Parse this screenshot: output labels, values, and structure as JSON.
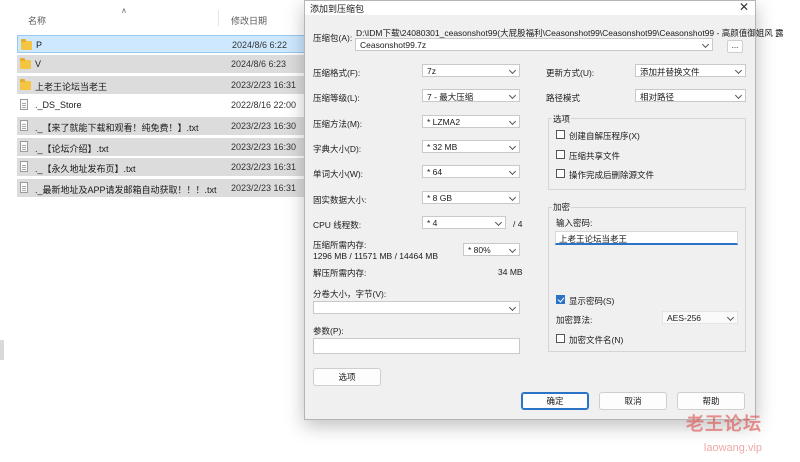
{
  "explorer": {
    "col_name": "名称",
    "col_date": "修改日期",
    "rows": [
      {
        "name": "P",
        "date": "2024/8/6 6:22",
        "type": "folder"
      },
      {
        "name": "V",
        "date": "2024/8/6 6:23",
        "type": "folder"
      },
      {
        "name": "上老王论坛当老王",
        "date": "2023/2/23 16:31",
        "type": "folder"
      },
      {
        "name": "._DS_Store",
        "date": "2022/8/16 22:00",
        "type": "file"
      },
      {
        "name": "._【来了就能下载和观看！纯免费！】.txt",
        "date": "2023/2/23 16:30",
        "type": "file"
      },
      {
        "name": "._【论坛介绍】.txt",
        "date": "2023/2/23 16:30",
        "type": "file"
      },
      {
        "name": "._【永久地址发布页】.txt",
        "date": "2023/2/23 16:31",
        "type": "file"
      },
      {
        "name": "._最新地址及APP请发邮箱自动获取！！！.txt",
        "date": "2023/2/23 16:31",
        "type": "file"
      }
    ]
  },
  "dialog": {
    "title": "添加到压缩包",
    "archive_label": "压缩包(A):",
    "archive_path": "D:\\IDM下载\\24080301_ceasonshot99(大屁股福利\\Ceasonshot99\\Ceasonshot99\\Ceasonshot99 - 高颜值御姐风 露",
    "archive_name": "Ceasonshot99.7z",
    "browse_label": "...",
    "format_label": "压缩格式(F):",
    "format_value": "7z",
    "level_label": "压缩等级(L):",
    "level_value": "7 - 最大压缩",
    "method_label": "压缩方法(M):",
    "method_value": "* LZMA2",
    "dict_label": "字典大小(D):",
    "dict_value": "* 32 MB",
    "word_label": "单词大小(W):",
    "word_value": "* 64",
    "solid_label": "固实数据大小:",
    "solid_value": "* 8 GB",
    "threads_label": "CPU 线程数:",
    "threads_value": "* 4",
    "threads_total": "/ 4",
    "mem_label": "压缩所需内存:",
    "mem_detail": "1296 MB / 11571 MB / 14464 MB",
    "mem_value": "* 80%",
    "decomp_label": "解压所需内存:",
    "decomp_value": "34 MB",
    "split_label": "分卷大小，字节(V):",
    "split_value": "",
    "params_label": "参数(P):",
    "options_button": "选项",
    "update_label": "更新方式(U):",
    "update_value": "添加并替换文件",
    "pathmode_label": "路径模式",
    "pathmode_value": "相对路径",
    "options_group": "选项",
    "opt_sfx": "创建自解压程序(X)",
    "opt_shared": "压缩共享文件",
    "opt_delete": "操作完成后删除源文件",
    "encrypt_group": "加密",
    "password_label": "输入密码:",
    "password_value": "上老王论坛当老王",
    "show_password": "显示密码(S)",
    "enc_method_label": "加密算法:",
    "enc_method_value": "AES-256",
    "enc_filenames": "加密文件名(N)",
    "ok_button": "确定",
    "cancel_button": "取消",
    "help_button": "帮助"
  },
  "watermark": {
    "line1": "老王论坛",
    "line2": "laowang.vip"
  }
}
